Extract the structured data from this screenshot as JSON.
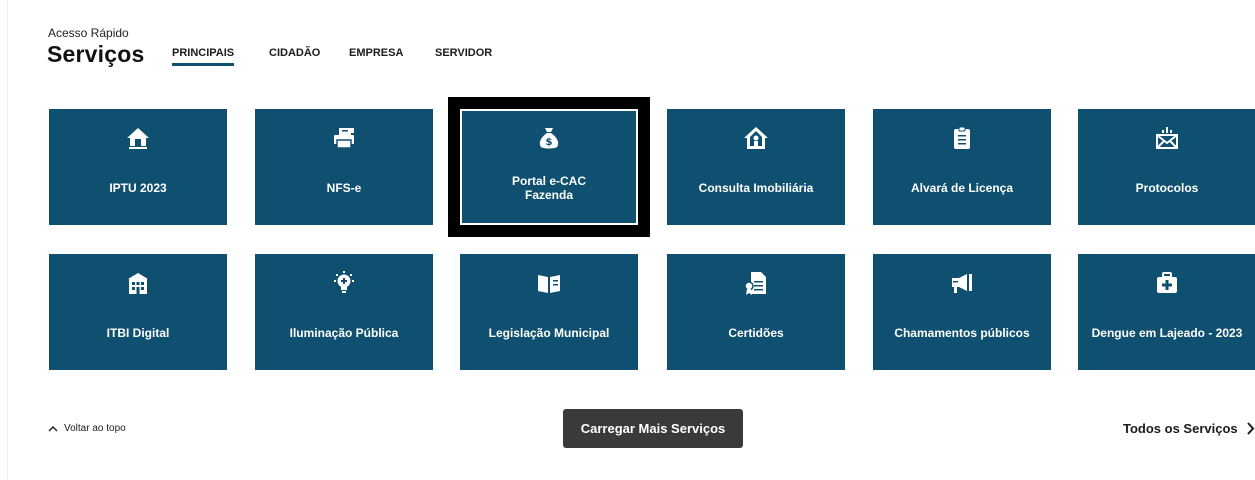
{
  "header": {
    "eyebrow": "Acesso Rápido",
    "title": "Serviços"
  },
  "tabs": [
    {
      "label": "PRINCIPAIS",
      "active": true
    },
    {
      "label": "CIDADÃO",
      "active": false
    },
    {
      "label": "EMPRESA",
      "active": false
    },
    {
      "label": "SERVIDOR",
      "active": false
    }
  ],
  "tiles": [
    {
      "label": "IPTU 2023",
      "icon": "house-tax-icon"
    },
    {
      "label": "NFS-e",
      "icon": "invoice-printer-icon"
    },
    {
      "label": "Portal e-CAC Fazenda",
      "icon": "money-bag-icon",
      "focused": true
    },
    {
      "label": "Consulta Imobiliária",
      "icon": "home-search-icon"
    },
    {
      "label": "Alvará de Licença",
      "icon": "clipboard-icon"
    },
    {
      "label": "Protocolos",
      "icon": "envelope-icon"
    },
    {
      "label": "ITBI Digital",
      "icon": "building-icon"
    },
    {
      "label": "Iluminação Pública",
      "icon": "lightbulb-icon"
    },
    {
      "label": "Legislação Municipal",
      "icon": "book-icon"
    },
    {
      "label": "Certidões",
      "icon": "certificate-icon"
    },
    {
      "label": "Chamamentos públicos",
      "icon": "megaphone-icon"
    },
    {
      "label": "Dengue em Lajeado - 2023",
      "icon": "first-aid-icon"
    }
  ],
  "footer": {
    "back_to_top": "Voltar ao topo",
    "load_more": "Carregar Mais Serviços",
    "all_services": "Todos os Serviços"
  },
  "colors": {
    "tile_bg": "#0f5070",
    "button_bg": "#3a3a3a",
    "focus_outline": "#000000"
  }
}
